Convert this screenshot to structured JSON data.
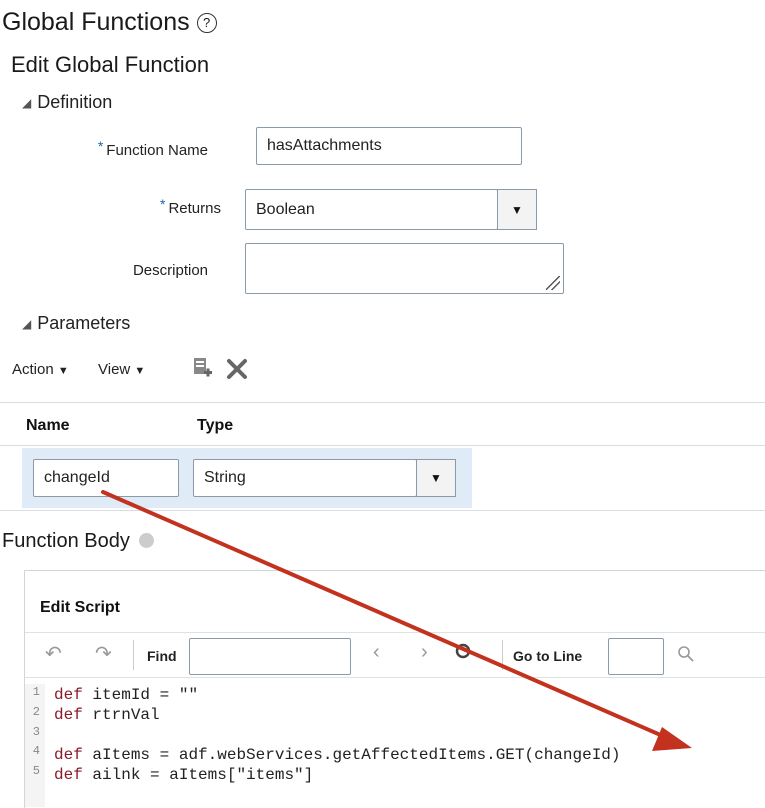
{
  "header": {
    "title": "Global Functions",
    "help_icon": "?"
  },
  "form": {
    "title": "Edit Global Function",
    "definition_section": "Definition",
    "function_name_label": "Function Name",
    "function_name_value": "hasAttachments",
    "returns_label": "Returns",
    "returns_value": "Boolean",
    "description_label": "Description",
    "description_value": "",
    "required_marker": "*"
  },
  "parameters": {
    "section": "Parameters",
    "toolbar": {
      "action": "Action",
      "view": "View",
      "add_icon": "add-row-icon",
      "delete_icon": "delete-icon"
    },
    "columns": [
      "Name",
      "Type"
    ],
    "rows": [
      {
        "name": "changeId",
        "type": "String"
      }
    ]
  },
  "function_body": {
    "title": "Function Body",
    "edit_script": "Edit Script",
    "find_label": "Find",
    "go_to_line_label": "Go to Line",
    "code_lines": [
      {
        "num": "1",
        "text": "itemId = \"\""
      },
      {
        "num": "2",
        "text": "rtrnVal"
      },
      {
        "num": "3",
        "text": ""
      },
      {
        "num": "4",
        "text": "aItems = adf.webServices.getAffectedItems.GET(changeId)"
      },
      {
        "num": "5",
        "text": "ailnk = aItems[\"items\"]"
      }
    ],
    "keyword": "def"
  },
  "colors": {
    "arrow": "#c2321e",
    "required": "#1d64b4",
    "row_highlight": "#dfebf7",
    "keyword": "#8b1a2a"
  }
}
